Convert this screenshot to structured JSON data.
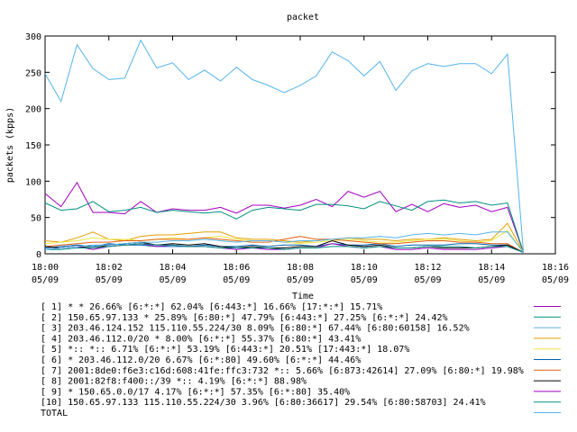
{
  "chart_data": {
    "type": "line",
    "title": "packet",
    "xlabel": "Time",
    "ylabel": "packets (kpps)",
    "ylim": [
      0,
      300
    ],
    "yticks": [
      0,
      50,
      100,
      150,
      200,
      250,
      300
    ],
    "xlim": [
      "18:00",
      "18:16"
    ],
    "xtick_labels": [
      {
        "time": "18:00",
        "date": "05/09"
      },
      {
        "time": "18:02",
        "date": "05/09"
      },
      {
        "time": "18:04",
        "date": "05/09"
      },
      {
        "time": "18:06",
        "date": "05/09"
      },
      {
        "time": "18:08",
        "date": "05/09"
      },
      {
        "time": "18:10",
        "date": "05/09"
      },
      {
        "time": "18:12",
        "date": "05/09"
      },
      {
        "time": "18:14",
        "date": "05/09"
      },
      {
        "time": "18:16",
        "date": "05/09"
      }
    ],
    "grid": false,
    "legend_position": "bottom",
    "x": [
      "18:00:00",
      "18:00:30",
      "18:01:00",
      "18:01:30",
      "18:02:00",
      "18:02:30",
      "18:03:00",
      "18:03:30",
      "18:04:00",
      "18:04:30",
      "18:05:00",
      "18:05:30",
      "18:06:00",
      "18:06:30",
      "18:07:00",
      "18:07:30",
      "18:08:00",
      "18:08:30",
      "18:09:00",
      "18:09:30",
      "18:10:00",
      "18:10:30",
      "18:11:00",
      "18:11:30",
      "18:12:00",
      "18:12:30",
      "18:13:00",
      "18:13:30",
      "18:14:00",
      "18:14:30",
      "18:15:00"
    ],
    "series": [
      {
        "name": "[ 1] * * 26.66%  [6:*:*] 62.04% [6:443:*] 16.66% [17:*:*] 15.71%",
        "color": "#a000c0",
        "values": [
          83,
          65,
          98,
          57,
          57,
          55,
          72,
          57,
          62,
          60,
          60,
          64,
          56,
          67,
          67,
          63,
          67,
          75,
          65,
          86,
          78,
          86,
          58,
          68,
          58,
          69,
          64,
          67,
          58,
          64,
          2
        ]
      },
      {
        "name": "[ 2] 150.65.97.133 * 25.89%  [6:80:*] 47.79% [6:443:*] 27.25% [6:*:*] 24.42%",
        "color": "#009080",
        "values": [
          70,
          60,
          62,
          72,
          58,
          60,
          64,
          57,
          60,
          58,
          56,
          58,
          48,
          60,
          64,
          62,
          60,
          68,
          68,
          66,
          62,
          72,
          66,
          60,
          72,
          74,
          70,
          72,
          67,
          70,
          2
        ]
      },
      {
        "name": "[ 3] 203.46.124.152 115.110.55.224/30 8.09%  [6:80:*] 67.44% [6:80:60158] 16.52%",
        "color": "#56b4e9",
        "values": [
          248,
          210,
          288,
          255,
          240,
          242,
          294,
          256,
          263,
          240,
          253,
          238,
          257,
          240,
          232,
          222,
          232,
          245,
          278,
          266,
          245,
          265,
          225,
          252,
          262,
          258,
          262,
          262,
          248,
          275,
          2
        ]
      },
      {
        "name": "[ 4] 203.46.112.0/20 * 8.00%  [6:*:*] 55.37% [6:80:*] 43.41%",
        "color": "#e0a000",
        "values": [
          18,
          16,
          22,
          30,
          20,
          18,
          24,
          26,
          26,
          28,
          30,
          30,
          22,
          20,
          20,
          18,
          16,
          18,
          20,
          22,
          20,
          20,
          18,
          20,
          20,
          22,
          20,
          18,
          20,
          42,
          2
        ]
      },
      {
        "name": "[ 5] *:: *:: 6.71%  [6:*:*] 53.19% [6:443:*] 20.51% [17:443:*] 18.07%",
        "color": "#f0e442",
        "values": [
          14,
          16,
          18,
          22,
          20,
          20,
          18,
          20,
          22,
          20,
          22,
          24,
          20,
          18,
          18,
          16,
          14,
          16,
          18,
          20,
          18,
          16,
          16,
          18,
          20,
          20,
          18,
          16,
          18,
          32,
          2
        ]
      },
      {
        "name": "[ 6] * 203.46.112.0/20 6.67%  [6:*:80] 49.60% [6:*:*] 44.46%",
        "color": "#0060b0",
        "values": [
          8,
          10,
          12,
          10,
          14,
          12,
          12,
          10,
          10,
          10,
          12,
          10,
          10,
          12,
          10,
          12,
          12,
          10,
          14,
          12,
          12,
          14,
          10,
          12,
          12,
          12,
          14,
          14,
          12,
          12,
          2
        ]
      },
      {
        "name": "[ 7] 2001:8de0:f6e3:c16d:608:41fe:ffc3:732 *:: 5.66%  [6:873:42614] 27.09% [6:80:*] 19.98%",
        "color": "#e06010",
        "values": [
          10,
          12,
          14,
          16,
          16,
          18,
          18,
          20,
          20,
          20,
          22,
          20,
          18,
          16,
          16,
          20,
          24,
          20,
          20,
          18,
          16,
          14,
          14,
          16,
          18,
          18,
          16,
          16,
          14,
          14,
          2
        ]
      },
      {
        "name": "[ 8] 2001:82f8:f400::/39 *:: 4.19%  [6:*:*] 88.98%",
        "color": "#000000",
        "values": [
          10,
          8,
          10,
          8,
          12,
          14,
          16,
          12,
          14,
          12,
          14,
          10,
          8,
          10,
          8,
          8,
          10,
          10,
          18,
          12,
          10,
          12,
          8,
          8,
          10,
          8,
          8,
          8,
          10,
          12,
          2
        ]
      },
      {
        "name": "[ 9] * 150.65.0.0/17 4.17%  [6:*:*] 57.35% [6:*:80] 35.40%",
        "color": "#a000c0",
        "values": [
          6,
          8,
          10,
          6,
          10,
          12,
          14,
          10,
          12,
          10,
          10,
          8,
          6,
          8,
          6,
          6,
          8,
          8,
          14,
          10,
          8,
          10,
          6,
          6,
          8,
          6,
          6,
          6,
          8,
          10,
          2
        ]
      },
      {
        "name": "[10] 150.65.97.133 115.110.55.224/30 3.96%  [6:80:36617] 29.54% [6:80:58703] 24.41%",
        "color": "#009080",
        "values": [
          6,
          6,
          8,
          8,
          10,
          12,
          14,
          12,
          12,
          10,
          10,
          8,
          8,
          8,
          8,
          6,
          8,
          8,
          10,
          10,
          8,
          10,
          8,
          8,
          10,
          10,
          10,
          8,
          10,
          10,
          2
        ]
      },
      {
        "name": "TOTAL",
        "color": "#56b4e9",
        "values": [
          6,
          8,
          10,
          12,
          12,
          14,
          16,
          16,
          18,
          18,
          20,
          18,
          16,
          18,
          18,
          16,
          18,
          18,
          20,
          22,
          22,
          24,
          22,
          26,
          28,
          26,
          28,
          26,
          30,
          30,
          2
        ]
      }
    ]
  }
}
